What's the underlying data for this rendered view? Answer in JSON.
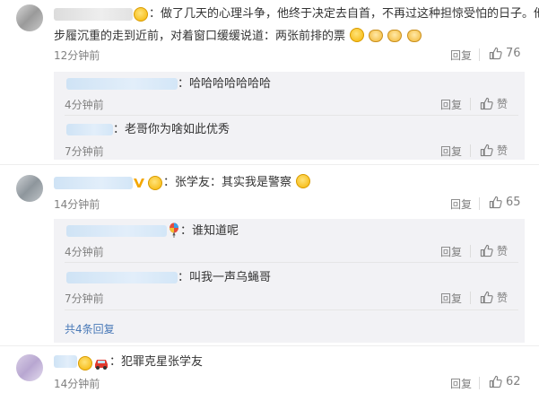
{
  "comments": [
    {
      "text_line1": "：做了几天的心理斗争，他终于决定去自首，不再过这种担惊受怕的日子。他",
      "text_line2": "步履沉重的走到近前，对着窗口缓缓说道：两张前排的票",
      "time": "12分钟前",
      "reply_label": "回复",
      "like_count": "76"
    },
    {
      "text": "：张学友：其实我是警察",
      "time": "14分钟前",
      "reply_label": "回复",
      "like_count": "65"
    },
    {
      "text": "：犯罪克星张学友",
      "time": "14分钟前",
      "reply_label": "回复",
      "like_count": "62"
    }
  ],
  "replies_group1": [
    {
      "text": "：哈哈哈哈哈哈哈",
      "time": "4分钟前",
      "reply_label": "回复",
      "like_label": "赞"
    },
    {
      "text": "：老哥你为啥如此优秀",
      "time": "7分钟前",
      "reply_label": "回复",
      "like_label": "赞"
    }
  ],
  "replies_group2": [
    {
      "text": "：谁知道呢",
      "time": "4分钟前",
      "reply_label": "回复",
      "like_label": "赞"
    },
    {
      "text": "：叫我一声乌蝇哥",
      "time": "7分钟前",
      "reply_label": "回复",
      "like_label": "赞"
    }
  ],
  "more_replies": "共4条回复",
  "icons": {
    "thumb": "thumb-up-icon",
    "emoji": "emoji-icon",
    "verified": "verified-v-icon"
  },
  "colors": {
    "link": "#4a7ab8",
    "muted": "#808080",
    "reply_bg": "#f2f2f5",
    "verified": "#f4a700"
  }
}
